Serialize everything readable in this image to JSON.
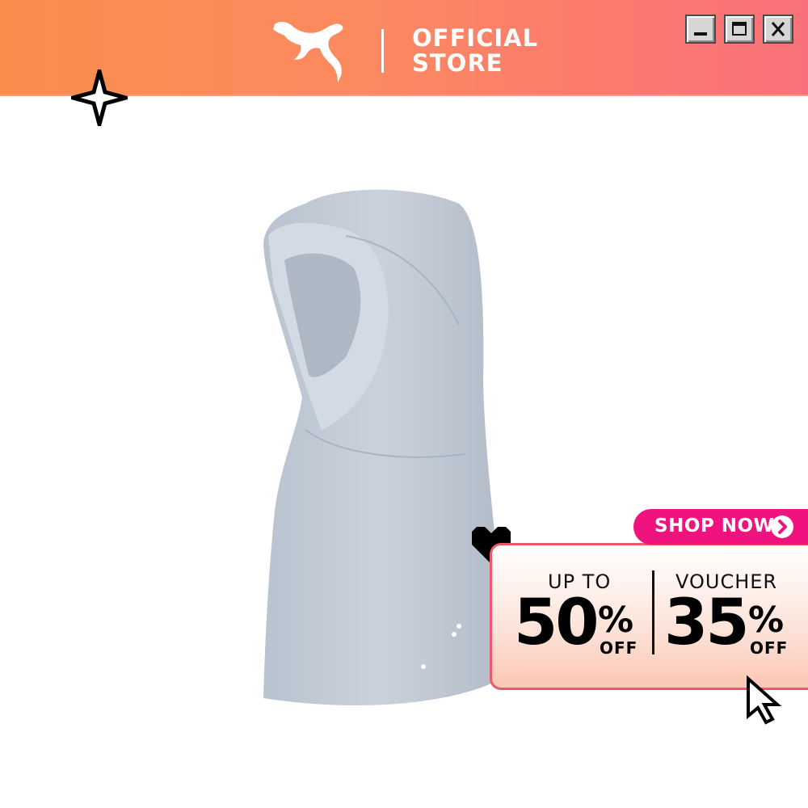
{
  "header": {
    "brand_icon": "puma-cat-logo",
    "store_line1": "OFFICIAL",
    "store_line2": "STORE",
    "window_buttons": [
      {
        "name": "minimize",
        "icon": "minimize-icon"
      },
      {
        "name": "maximize",
        "icon": "maximize-icon"
      },
      {
        "name": "close",
        "icon": "close-icon"
      }
    ]
  },
  "decorations": {
    "sparkle_icon": "sparkle-icon",
    "heart_icon": "heart-icon",
    "cursor_icon": "pointer-cursor-icon"
  },
  "product": {
    "image": "grey-sports-hijab"
  },
  "promo": {
    "cta_label": "SHOP NOW",
    "deal1": {
      "top": "UP TO",
      "number": "50",
      "percent": "%",
      "off": "OFF"
    },
    "deal2": {
      "top": "VOUCHER",
      "number": "35",
      "percent": "%",
      "off": "OFF"
    }
  },
  "colors": {
    "header_start": "#f98d4e",
    "header_end": "#f8717a",
    "cta": "#f0137f",
    "promo_border": "#f2566a"
  }
}
